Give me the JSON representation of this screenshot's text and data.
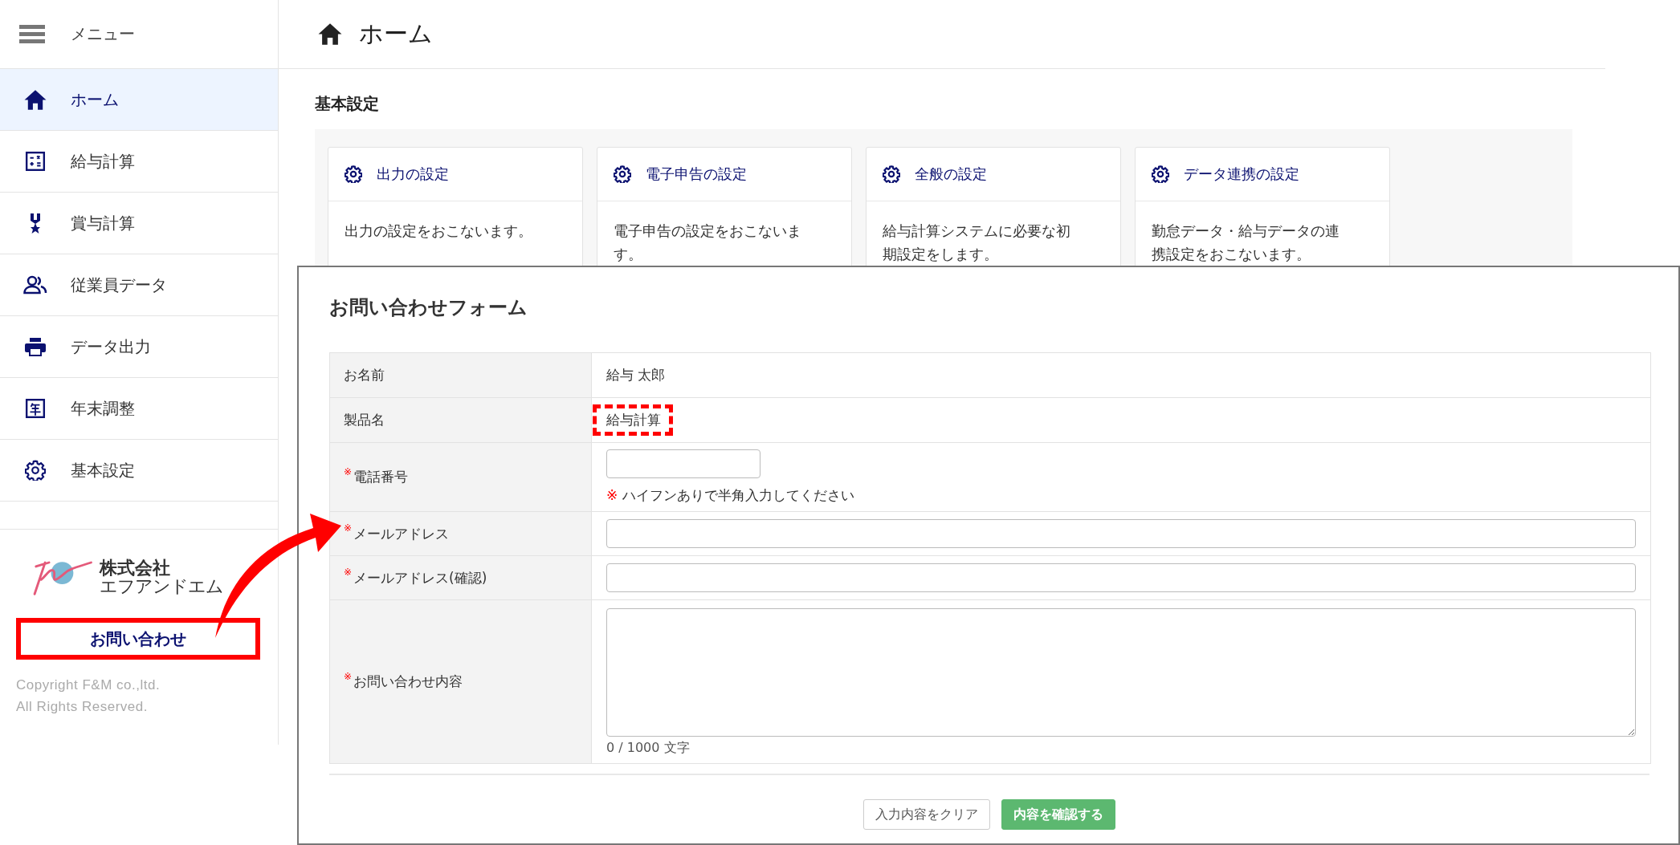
{
  "sidebar": {
    "menu_label": "メニュー",
    "items": [
      {
        "label": "ホーム",
        "selected": true
      },
      {
        "label": "給与計算",
        "selected": false
      },
      {
        "label": "賞与計算",
        "selected": false
      },
      {
        "label": "従業員データ",
        "selected": false
      },
      {
        "label": "データ出力",
        "selected": false
      },
      {
        "label": "年末調整",
        "selected": false
      },
      {
        "label": "基本設定",
        "selected": false
      }
    ],
    "logo_lines": [
      "株式会社",
      "エフアンドエム"
    ],
    "contact_button": {
      "label": "お問い合わせ",
      "highlighted": true
    },
    "copyright": [
      "Copyright F&M co.,ltd.",
      "All Rights Reserved."
    ]
  },
  "header": {
    "title": "ホーム"
  },
  "section": {
    "title": "基本設定",
    "cards": [
      {
        "title": "出力の設定",
        "description": "出力の設定をおこないます。"
      },
      {
        "title": "電子申告の設定",
        "description": "電子申告の設定をおこないます。"
      },
      {
        "title": "全般の設定",
        "description": "給与計算システムに必要な初期設定をします。"
      },
      {
        "title": "データ連携の設定",
        "description": "勤怠データ・給与データの連携設定をおこないます。"
      }
    ]
  },
  "form": {
    "title": "お問い合わせフォーム",
    "required_mark": "※",
    "rows": [
      {
        "label": "お名前",
        "required": false,
        "kind": "static",
        "value": "給与 太郎",
        "highlighted": false
      },
      {
        "label": "製品名",
        "required": false,
        "kind": "static",
        "value": "給与計算",
        "highlighted": true
      },
      {
        "label": "電話番号",
        "required": true,
        "kind": "short-input",
        "hint_mark": "※",
        "hint": "ハイフンありで半角入力してください"
      },
      {
        "label": "メールアドレス",
        "required": true,
        "kind": "input"
      },
      {
        "label": "メールアドレス(確認)",
        "required": true,
        "kind": "input"
      },
      {
        "label": "お問い合わせ内容",
        "required": true,
        "kind": "textarea",
        "counter": "0 / 1000 文字"
      }
    ],
    "buttons": [
      {
        "label": "入力内容をクリア",
        "kind": "secondary"
      },
      {
        "label": "内容を確認する",
        "kind": "primary"
      }
    ]
  }
}
